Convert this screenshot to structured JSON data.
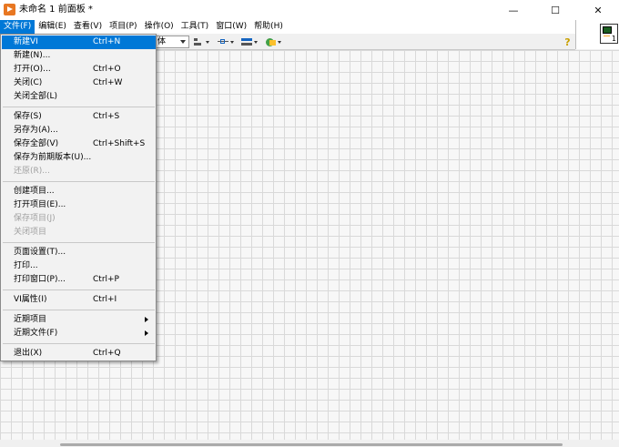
{
  "window": {
    "title": "未命名 1 前面板 *",
    "minimize_glyph": "—",
    "maximize_glyph": "☐",
    "close_glyph": "✕"
  },
  "menubar": [
    {
      "label": "文件(F)",
      "active": true
    },
    {
      "label": "编辑(E)"
    },
    {
      "label": "查看(V)"
    },
    {
      "label": "项目(P)"
    },
    {
      "label": "操作(O)"
    },
    {
      "label": "工具(T)"
    },
    {
      "label": "窗口(W)"
    },
    {
      "label": "帮助(H)"
    }
  ],
  "toolbar": {
    "font_value": "体",
    "help_glyph": "?"
  },
  "vi_icon": {
    "number": "1"
  },
  "file_menu": {
    "items": [
      {
        "label": "新建VI",
        "shortcut": "Ctrl+N",
        "highlighted": true
      },
      {
        "label": "新建(N)...",
        "shortcut": ""
      },
      {
        "label": "打开(O)...",
        "shortcut": "Ctrl+O"
      },
      {
        "label": "关闭(C)",
        "shortcut": "Ctrl+W"
      },
      {
        "label": "关闭全部(L)",
        "shortcut": ""
      },
      {
        "label": "保存(S)",
        "shortcut": "Ctrl+S"
      },
      {
        "label": "另存为(A)...",
        "shortcut": ""
      },
      {
        "label": "保存全部(V)",
        "shortcut": "Ctrl+Shift+S"
      },
      {
        "label": "保存为前期版本(U)...",
        "shortcut": ""
      },
      {
        "label": "还原(R)...",
        "shortcut": "",
        "disabled": true
      },
      {
        "label": "创建项目...",
        "shortcut": ""
      },
      {
        "label": "打开项目(E)...",
        "shortcut": ""
      },
      {
        "label": "保存项目(J)",
        "shortcut": "",
        "disabled": true
      },
      {
        "label": "关闭项目",
        "shortcut": "",
        "disabled": true
      },
      {
        "label": "页面设置(T)...",
        "shortcut": ""
      },
      {
        "label": "打印...",
        "shortcut": ""
      },
      {
        "label": "打印窗口(P)...",
        "shortcut": "Ctrl+P"
      },
      {
        "label": "VI属性(I)",
        "shortcut": "Ctrl+I"
      },
      {
        "label": "近期项目",
        "shortcut": "",
        "submenu": true
      },
      {
        "label": "近期文件(F)",
        "shortcut": "",
        "submenu": true
      },
      {
        "label": "退出(X)",
        "shortcut": "Ctrl+Q"
      }
    ]
  }
}
